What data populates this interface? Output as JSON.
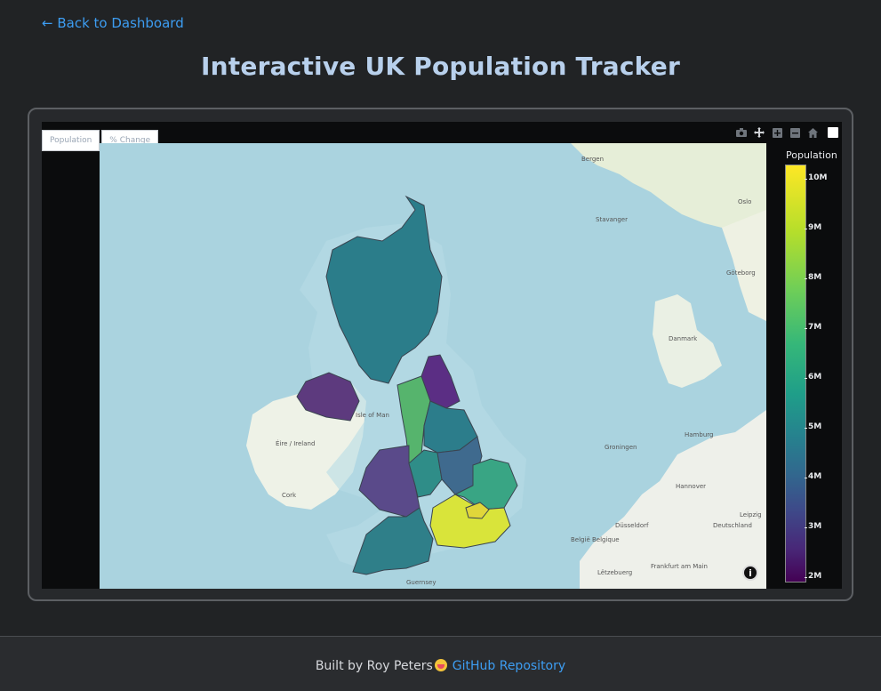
{
  "nav": {
    "back_label": "← Back to Dashboard"
  },
  "header": {
    "title": "Interactive UK Population Tracker"
  },
  "plot": {
    "tabs": [
      {
        "label": "Population"
      },
      {
        "label": "% Change"
      }
    ],
    "modebar": [
      {
        "icon": "camera-icon"
      },
      {
        "icon": "pan-icon"
      },
      {
        "icon": "zoom-in-icon"
      },
      {
        "icon": "zoom-out-icon"
      },
      {
        "icon": "home-icon"
      },
      {
        "icon": "autoscale-icon"
      }
    ],
    "map_labels": {
      "bergen": "Bergen",
      "oslo": "Oslo",
      "stavanger": "Stavanger",
      "goteborg": "Göteborg",
      "danmark": "Danmark",
      "eire": "Éire / Ireland",
      "isle_of_man": "Isle of Man",
      "cork": "Cork",
      "hamburg": "Hamburg",
      "groningen": "Groningen",
      "hannover": "Hannover",
      "deutschland": "Deutschland",
      "belgie": "België Belgique",
      "leipzig": "Leipzig",
      "dusseldorf": "Düsseldorf",
      "frankfurt": "Frankfurt am Main",
      "luxembourg": "Lëtzebuerg",
      "guernsey": "Guernsey"
    },
    "colorbar": {
      "title": "Population",
      "ticks": [
        "10M",
        "9M",
        "8M",
        "7M",
        "6M",
        "5M",
        "4M",
        "3M",
        "2M"
      ],
      "range": [
        2000000,
        10300000
      ],
      "colorscale": "Viridis"
    },
    "regions": [
      {
        "name": "Scotland",
        "color": "#2b7d8a"
      },
      {
        "name": "Northern Ireland",
        "color": "#5d3a7e"
      },
      {
        "name": "North East",
        "color": "#5b2e84"
      },
      {
        "name": "North West",
        "color": "#56b46d"
      },
      {
        "name": "Yorkshire and The Humber",
        "color": "#2c7d8b"
      },
      {
        "name": "Wales",
        "color": "#5a4a8a"
      },
      {
        "name": "West Midlands",
        "color": "#2f8d88"
      },
      {
        "name": "East Midlands",
        "color": "#3f6a8e"
      },
      {
        "name": "East of England",
        "color": "#39a584"
      },
      {
        "name": "London",
        "color": "#d8e03a"
      },
      {
        "name": "South East",
        "color": "#d9e43a"
      },
      {
        "name": "South West",
        "color": "#2f7f89"
      }
    ]
  },
  "footer": {
    "built_by": "Built by Roy Peters",
    "repo_link": "GitHub Repository"
  }
}
